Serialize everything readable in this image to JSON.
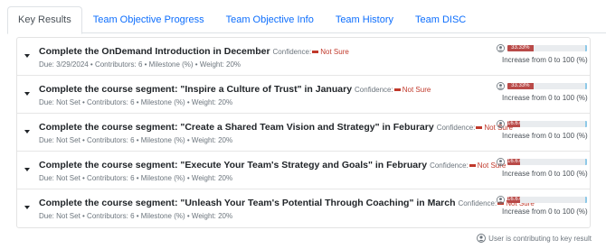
{
  "tabs": [
    {
      "label": "Key Results",
      "active": true
    },
    {
      "label": "Team Objective Progress",
      "active": false
    },
    {
      "label": "Team Objective Info",
      "active": false
    },
    {
      "label": "Team History",
      "active": false
    },
    {
      "label": "Team DISC",
      "active": false
    }
  ],
  "key_results": [
    {
      "title": "Complete the OnDemand Introduction in December",
      "confidence_label": "Confidence:",
      "confidence": "Not Sure",
      "meta": "Due: 3/29/2024 • Contributors: 6 • Milestone (%) • Weight: 20%",
      "progress_label": "33.33%",
      "progress": 0.3333,
      "progress_text": "Increase from 0 to 100 (%)"
    },
    {
      "title": "Complete the course segment: \"Inspire a Culture of Trust\" in January",
      "confidence_label": "Confidence:",
      "confidence": "Not Sure",
      "meta": "Due: Not Set • Contributors: 6 • Milestone (%) • Weight: 20%",
      "progress_label": "33.33%",
      "progress": 0.3333,
      "progress_text": "Increase from 0 to 100 (%)"
    },
    {
      "title": "Complete the course segment: \"Create a Shared Team Vision and Strategy\" in Feburary",
      "confidence_label": "Confidence:",
      "confidence": "Not Sure",
      "meta": "Due: Not Set • Contributors: 6 • Milestone (%) • Weight: 20%",
      "progress_label": "16.67%",
      "progress": 0.1667,
      "progress_text": "Increase from 0 to 100 (%)"
    },
    {
      "title": "Complete the course segment: \"Execute Your Team's Strategy and Goals\" in February",
      "confidence_label": "Confidence:",
      "confidence": "Not Sure",
      "meta": "Due: Not Set • Contributors: 6 • Milestone (%) • Weight: 20%",
      "progress_label": "16.67%",
      "progress": 0.1667,
      "progress_text": "Increase from 0 to 100 (%)"
    },
    {
      "title": "Complete the course segment: \"Unleash Your Team's Potential Through Coaching\" in March",
      "confidence_label": "Confidence:",
      "confidence": "Not Sure",
      "meta": "Due: Not Set • Contributors: 6 • Milestone (%) • Weight: 20%",
      "progress_label": "16.67%",
      "progress": 0.1667,
      "progress_text": "Increase from 0 to 100 (%)"
    }
  ],
  "footer": {
    "text": "User is contributing to key result",
    "icon": "user-circle-icon"
  },
  "colors": {
    "tab_link": "#0d6efd",
    "progress_fill": "#b94a48",
    "not_sure": "#c0392b"
  }
}
